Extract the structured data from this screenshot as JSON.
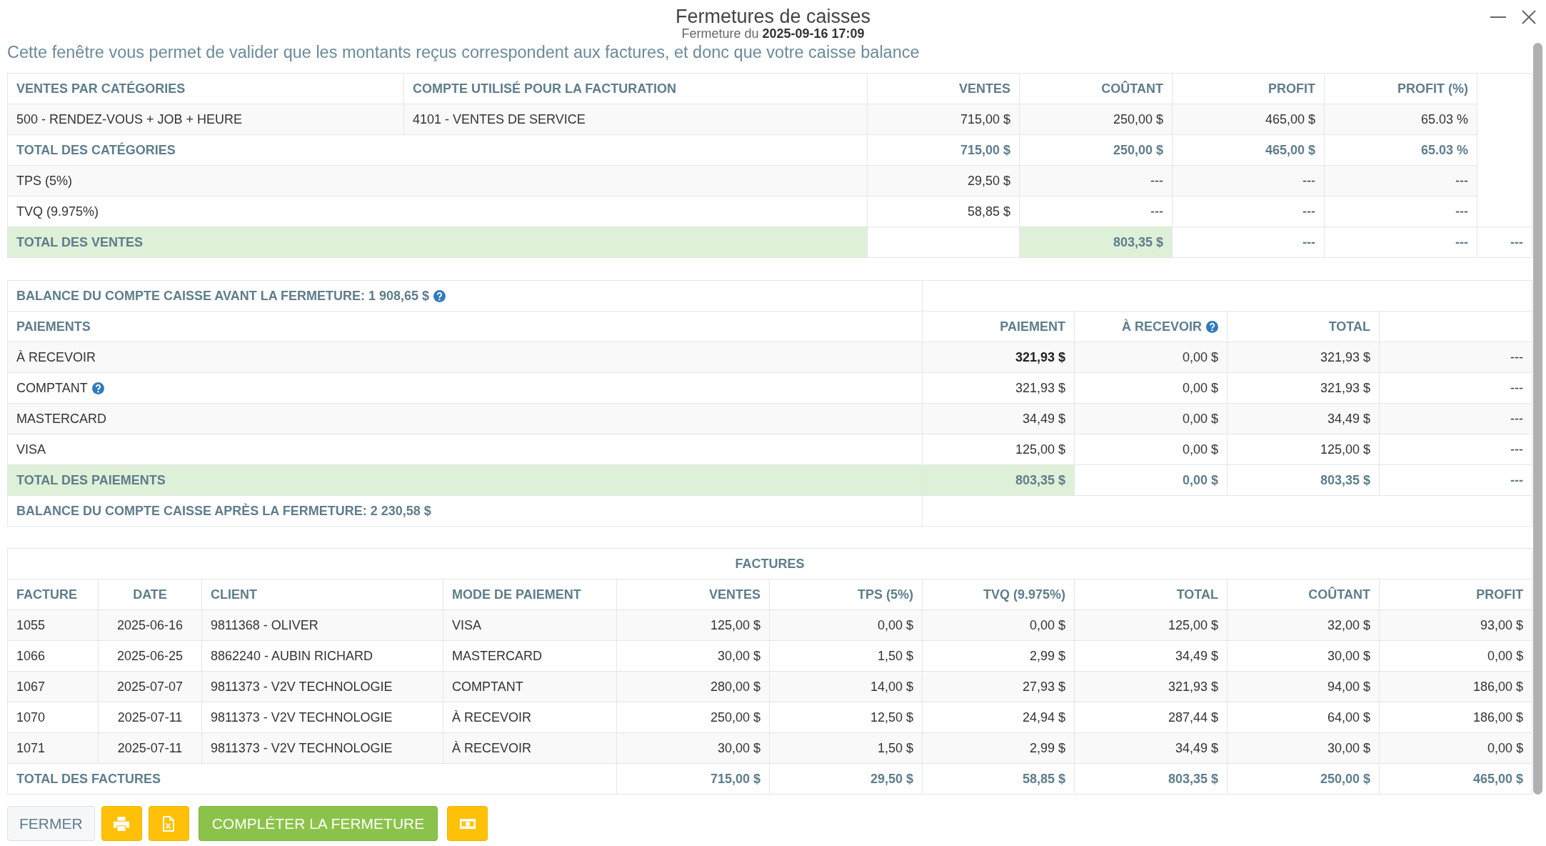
{
  "window": {
    "title": "Fermetures de caisses",
    "subtitle": "Fermeture du **2025-09-16 17:09**"
  },
  "description": "Cette fenêtre vous permet de valider que les montants reçus correspondent aux factures, et donc que votre caisse balance",
  "categories_table": {
    "columns": [
      "VENTES PAR CATÉGORIES",
      "COMPTE UTILISÉ POUR LA FACTURATION",
      "VENTES",
      "COÛTANT",
      "PROFIT",
      "PROFIT (%)"
    ],
    "rows": [
      {
        "kind": "category",
        "category": "500 - RENDEZ-VOUS + JOB + HEURE",
        "account": "4101 - VENTES DE SERVICE",
        "values": [
          "715,00 $",
          "250,00 $",
          "465,00 $",
          "65.03 %"
        ]
      },
      {
        "kind": "total",
        "label": "TOTAL DES CATÉGORIES",
        "values": [
          "715,00 $",
          "250,00 $",
          "465,00 $",
          "65.03 %"
        ]
      },
      {
        "kind": "tax",
        "label": "TPS (5%)",
        "values": [
          "29,50 $",
          "---",
          "---",
          "---"
        ]
      },
      {
        "kind": "tax",
        "label": "TVQ (9.975%)",
        "values": [
          "58,85 $",
          "---",
          "---",
          "---"
        ]
      }
    ],
    "grand_total": {
      "label": "TOTAL DES VENTES",
      "values": [
        "803,35 $",
        "---",
        "---",
        "---"
      ]
    }
  },
  "cash_table": {
    "balance_before": {
      "label": "BALANCE DU COMPTE CAISSE AVANT LA FERMETURE: 1 908,65 $",
      "help": true
    },
    "columns": [
      {
        "label": "PAIEMENTS",
        "help": false
      },
      {
        "label": "PAIEMENT",
        "help": false
      },
      {
        "label": "À RECEVOIR",
        "help": true
      },
      {
        "label": "TOTAL",
        "help": false
      }
    ],
    "rows": [
      {
        "method": "À RECEVOIR",
        "help": false,
        "payment": "321,93 $",
        "payment_bold": true,
        "receivable": "0,00 $",
        "total": "321,93 $",
        "column_5": "---"
      },
      {
        "method": "COMPTANT",
        "help": true,
        "payment": "321,93 $",
        "payment_bold": false,
        "receivable": "0,00 $",
        "total": "321,93 $",
        "column_5": "---"
      },
      {
        "method": "MASTERCARD",
        "help": false,
        "payment": "34,49 $",
        "payment_bold": false,
        "receivable": "0,00 $",
        "total": "34,49 $",
        "column_5": "---"
      },
      {
        "method": "VISA",
        "help": false,
        "payment": "125,00 $",
        "payment_bold": false,
        "receivable": "0,00 $",
        "total": "125,00 $",
        "column_5": "---"
      }
    ],
    "total": {
      "label": "TOTAL DES PAIEMENTS",
      "payment": "803,35 $",
      "receivable": "0,00 $",
      "total": "803,35 $",
      "column_5": "---"
    },
    "balance_after": {
      "label": "BALANCE DU COMPTE CAISSE APRÈS LA FERMETURE: 2 230,58 $",
      "help": false
    }
  },
  "invoices_table": {
    "title": "FACTURES",
    "columns": [
      "FACTURE",
      "DATE",
      "CLIENT",
      "MODE DE PAIEMENT",
      "VENTES",
      "TPS (5%)",
      "TVQ (9.975%)",
      "TOTAL",
      "COÛTANT",
      "PROFIT"
    ],
    "rows": [
      {
        "invoice": "1055",
        "date": "2025-06-16",
        "client": "9811368 - OLIVER",
        "payment_method": "VISA",
        "amounts": [
          "125,00 $",
          "0,00 $",
          "0,00 $",
          "125,00 $",
          "32,00 $",
          "93,00 $"
        ]
      },
      {
        "invoice": "1066",
        "date": "2025-06-25",
        "client": "8862240 - AUBIN RICHARD",
        "payment_method": "MASTERCARD",
        "amounts": [
          "30,00 $",
          "1,50 $",
          "2,99 $",
          "34,49 $",
          "30,00 $",
          "0,00 $"
        ]
      },
      {
        "invoice": "1067",
        "date": "2025-07-07",
        "client": "9811373 - V2V TECHNOLOGIE",
        "payment_method": "COMPTANT",
        "amounts": [
          "280,00 $",
          "14,00 $",
          "27,93 $",
          "321,93 $",
          "94,00 $",
          "186,00 $"
        ]
      },
      {
        "invoice": "1070",
        "date": "2025-07-11",
        "client": "9811373 - V2V TECHNOLOGIE",
        "payment_method": "À RECEVOIR",
        "amounts": [
          "250,00 $",
          "12,50 $",
          "24,94 $",
          "287,44 $",
          "64,00 $",
          "186,00 $"
        ]
      },
      {
        "invoice": "1071",
        "date": "2025-07-11",
        "client": "9811373 - V2V TECHNOLOGIE",
        "payment_method": "À RECEVOIR",
        "amounts": [
          "30,00 $",
          "1,50 $",
          "2,99 $",
          "34,49 $",
          "30,00 $",
          "0,00 $"
        ]
      }
    ],
    "total": {
      "label": "TOTAL DES FACTURES",
      "amounts": [
        "715,00 $",
        "29,50 $",
        "58,85 $",
        "803,35 $",
        "250,00 $",
        "465,00 $"
      ]
    }
  },
  "buttons": [
    {
      "kind": "close",
      "label": "FERMER"
    },
    {
      "kind": "print"
    },
    {
      "kind": "export"
    },
    {
      "kind": "complete",
      "label": "COMPLÉTER LA FERMETURE"
    },
    {
      "kind": "cash"
    }
  ]
}
